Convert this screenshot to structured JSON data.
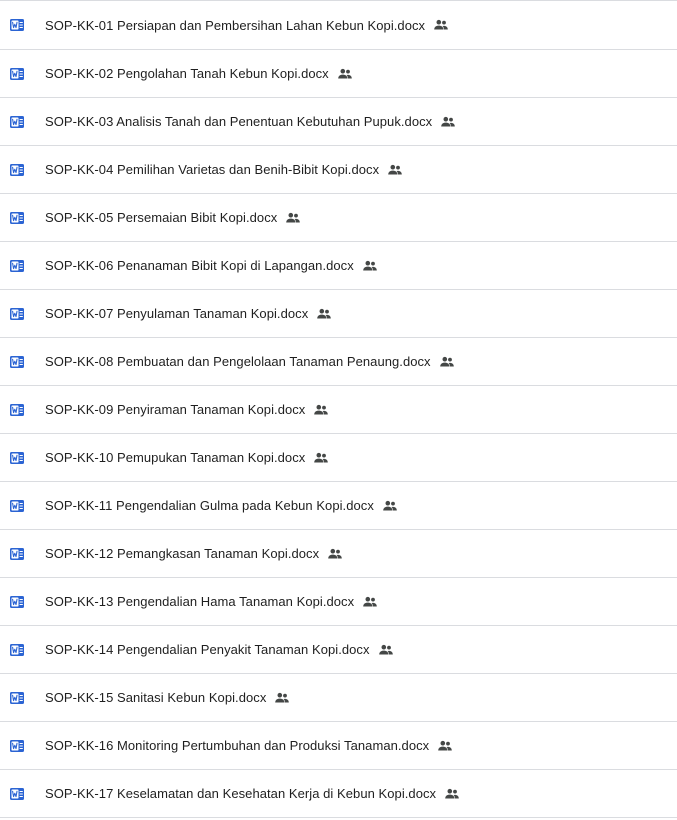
{
  "colors": {
    "word_icon": "#2b64d3",
    "text": "#1f1f1f",
    "divider": "#dadce0",
    "shared_icon": "#444746"
  },
  "file_icon": "word-doc-icon",
  "shared_icon": "people-icon",
  "files": [
    {
      "name": "SOP-KK-01 Persiapan dan Pembersihan Lahan Kebun Kopi.docx"
    },
    {
      "name": "SOP-KK-02 Pengolahan Tanah Kebun Kopi.docx"
    },
    {
      "name": "SOP-KK-03 Analisis Tanah dan Penentuan Kebutuhan Pupuk.docx"
    },
    {
      "name": "SOP-KK-04 Pemilihan Varietas dan Benih-Bibit Kopi.docx"
    },
    {
      "name": "SOP-KK-05 Persemaian Bibit Kopi.docx"
    },
    {
      "name": "SOP-KK-06 Penanaman Bibit Kopi di Lapangan.docx"
    },
    {
      "name": "SOP-KK-07 Penyulaman Tanaman Kopi.docx"
    },
    {
      "name": "SOP-KK-08 Pembuatan dan Pengelolaan Tanaman Penaung.docx"
    },
    {
      "name": "SOP-KK-09 Penyiraman Tanaman Kopi.docx"
    },
    {
      "name": "SOP-KK-10 Pemupukan Tanaman Kopi.docx"
    },
    {
      "name": "SOP-KK-11 Pengendalian Gulma pada Kebun Kopi.docx"
    },
    {
      "name": "SOP-KK-12 Pemangkasan Tanaman Kopi.docx"
    },
    {
      "name": "SOP-KK-13 Pengendalian Hama Tanaman Kopi.docx"
    },
    {
      "name": "SOP-KK-14 Pengendalian Penyakit Tanaman Kopi.docx"
    },
    {
      "name": "SOP-KK-15 Sanitasi Kebun Kopi.docx"
    },
    {
      "name": "SOP-KK-16 Monitoring Pertumbuhan dan Produksi Tanaman.docx"
    },
    {
      "name": "SOP-KK-17 Keselamatan dan Kesehatan Kerja di Kebun Kopi.docx"
    }
  ]
}
